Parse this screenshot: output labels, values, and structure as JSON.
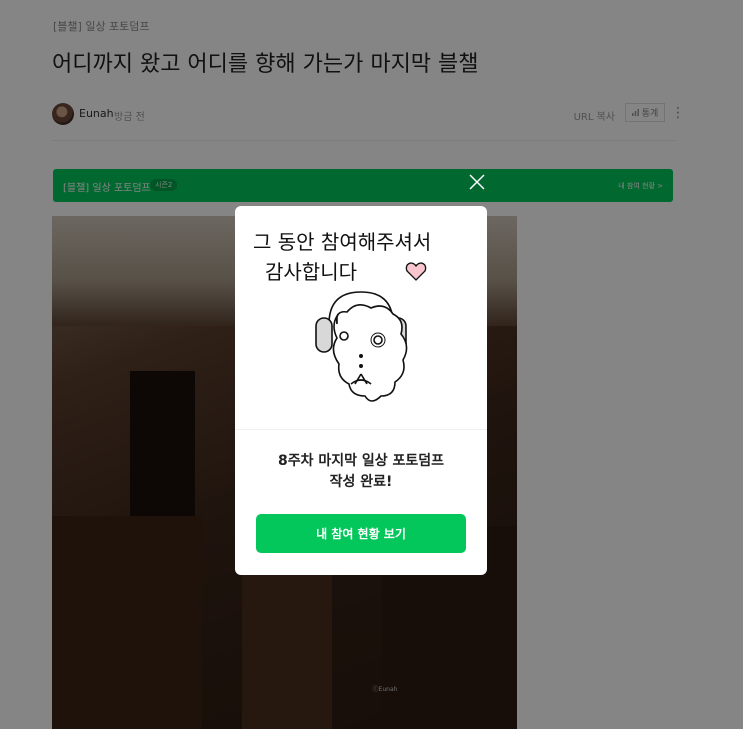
{
  "post": {
    "category": "[블챌] 일상 포토덤프",
    "title": "어디까지 왔고 어디를 향해 가는가 마지막 블챌",
    "author": "Eunah",
    "time": "방금 전",
    "url_copy": "URL 복사",
    "stats_label": "통계"
  },
  "banner": {
    "title": "[블챌] 일상 포토덤프",
    "chip": "시즌2",
    "link": "내 참여 현황 >"
  },
  "photo": {
    "watermark": "ⓒEunah"
  },
  "modal": {
    "illust_line1": "그 동안 참여해주셔서",
    "illust_line2": "감사합니다",
    "message_line1": "8주차 마지막 일상 포토덤프",
    "message_line2": "작성 완료!",
    "cta_label": "내 참여 현황 보기"
  },
  "colors": {
    "accent": "#03c75a",
    "overlay": "rgba(0,0,0,0.48)"
  },
  "icons": [
    "close-icon",
    "more-vertical-icon",
    "stats-icon",
    "heart-icon"
  ]
}
